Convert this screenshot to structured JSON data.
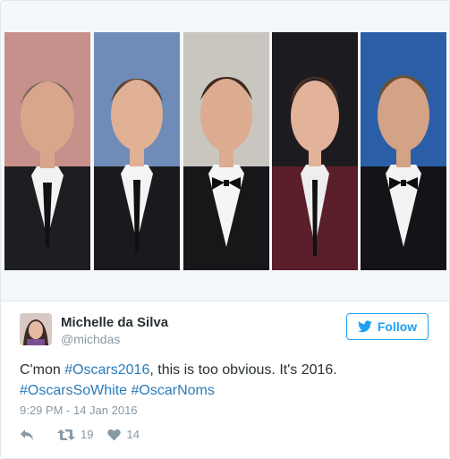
{
  "tweet": {
    "author_name": "Michelle da Silva",
    "author_handle": "@michdas",
    "follow_label": "Follow",
    "text_before": "C'mon ",
    "hashtag1": "#Oscars2016",
    "text_after": ", this is too obvious. It's 2016.",
    "hashtag2": "#OscarsSoWhite",
    "hashtag3": "#OscarNoms",
    "timestamp": "9:29 PM - 14 Jan 2016",
    "retweet_count": "19",
    "like_count": "14"
  },
  "colors": {
    "accent": "#1da1f2",
    "link": "#2b7bb9",
    "muted": "#8899a6",
    "text": "#292f33",
    "border": "#e1e8ed"
  },
  "icons": {
    "follow": "twitter-bird-icon",
    "reply": "reply-icon",
    "retweet": "retweet-icon",
    "like": "heart-icon"
  }
}
